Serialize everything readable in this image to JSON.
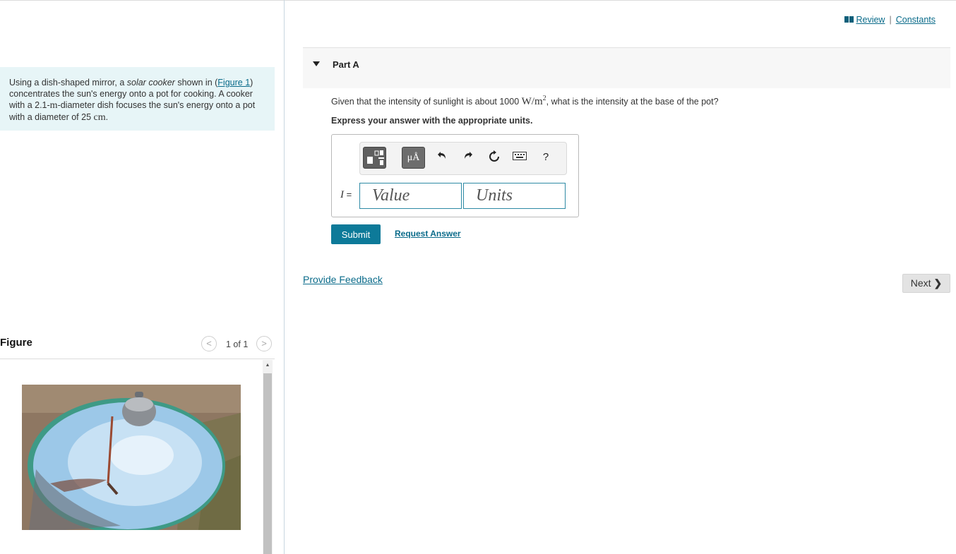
{
  "header": {
    "review_label": "Review",
    "constants_label": "Constants",
    "separator": "|"
  },
  "problem": {
    "text_1": "Using a dish-shaped mirror, a ",
    "text_italic": "solar cooker",
    "text_2": " shown in (",
    "figure_link": "Figure 1",
    "text_3": ") concentrates the sun's energy onto a pot for cooking. A cooker with a 2.1-",
    "unit_m": "m",
    "text_4": "-diameter dish focuses the sun's energy onto a pot with a diameter of 25 ",
    "unit_cm": "cm",
    "text_5": "."
  },
  "figure": {
    "title": "Figure",
    "counter": "1 of 1",
    "prev_symbol": "<",
    "next_symbol": ">"
  },
  "part": {
    "title": "Part A",
    "question_1": "Given that the intensity of sunlight is about 1000 ",
    "question_unit": "W/m",
    "question_exp": "2",
    "question_2": ", what is the intensity at the base of the pot?",
    "instruction": "Express your answer with the appropriate units."
  },
  "answer": {
    "variable": "I",
    "equals": " =",
    "value_placeholder": "Value",
    "units_placeholder": "Units",
    "units_button_label": "μÅ",
    "help_label": "?"
  },
  "actions": {
    "submit_label": "Submit",
    "request_answer_label": "Request Answer",
    "feedback_label": "Provide Feedback",
    "next_label": "Next"
  },
  "colors": {
    "accent": "#0d7a99",
    "problem_bg": "#e7f5f7",
    "link": "#0a6b8a"
  }
}
